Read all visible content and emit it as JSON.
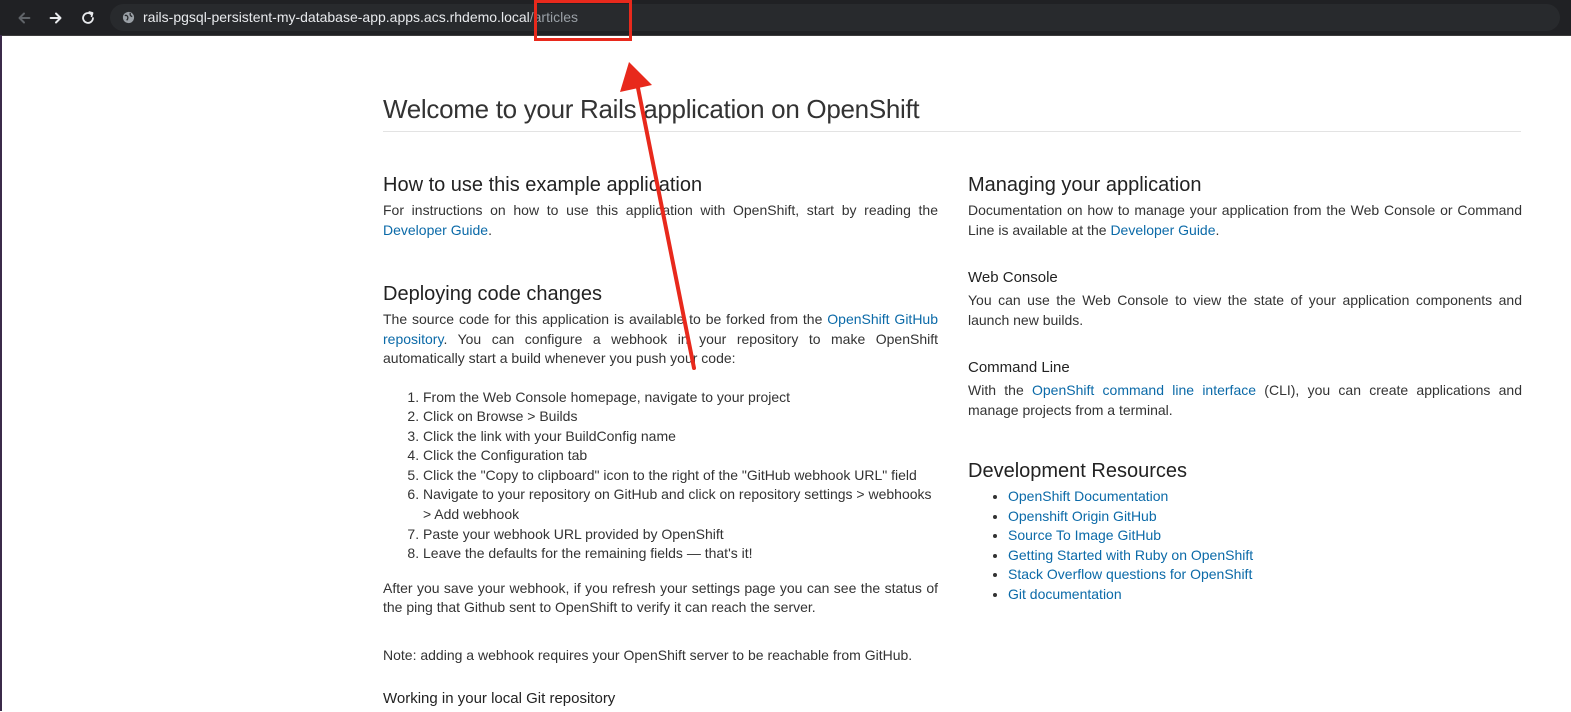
{
  "browser": {
    "url_host": "rails-pgsql-persistent-my-database-app.apps.acs.rhdemo.l",
    "url_host_tail": "ocal",
    "url_path": "/articles",
    "icons": [
      "back-arrow-icon",
      "forward-arrow-icon",
      "reload-icon",
      "globe-icon"
    ]
  },
  "page": {
    "title": "Welcome to your Rails application on OpenShift",
    "how_to": {
      "heading": "How to use this example application",
      "text": "For instructions on how to use this application with OpenShift, start by reading the ",
      "link": "Developer Guide",
      "text_end": "."
    },
    "deploying": {
      "heading": "Deploying code changes",
      "text1": "The source code for this application is available to be forked from the ",
      "link": "OpenShift GitHub repository",
      "text2": ". You can configure a webhook in your repository to make OpenShift automatically start a build whenever you push your code:",
      "steps": [
        "From the Web Console homepage, navigate to your project",
        "Click on Browse > Builds",
        "Click the link with your BuildConfig name",
        "Click the Configuration tab",
        "Click the \"Copy to clipboard\" icon to the right of the \"GitHub webhook URL\" field",
        "Navigate to your repository on GitHub and click on repository settings > webhooks > Add webhook",
        "Paste your webhook URL provided by OpenShift",
        "Leave the defaults for the remaining fields — that's it!"
      ],
      "after": "After you save your webhook, if you refresh your settings page you can see the status of the ping that Github sent to OpenShift to verify it can reach the server.",
      "note": "Note: adding a webhook requires your OpenShift server to be reachable from GitHub.",
      "cut_heading": "Working in your local Git repository"
    },
    "managing": {
      "heading": "Managing your application",
      "text": "Documentation on how to manage your application from the Web Console or Command Line is available at the ",
      "link": "Developer Guide",
      "text_end": "."
    },
    "web_console": {
      "heading": "Web Console",
      "text": "You can use the Web Console to view the state of your application components and launch new builds."
    },
    "command_line": {
      "heading": "Command Line",
      "text1": "With the ",
      "link": "OpenShift command line interface",
      "text2": " (CLI), you can create applications and manage projects from a terminal."
    },
    "resources": {
      "heading": "Development Resources",
      "links": [
        "OpenShift Documentation",
        "Openshift Origin GitHub",
        "Source To Image GitHub",
        "Getting Started with Ruby on OpenShift",
        "Stack Overflow questions for OpenShift",
        "Git documentation"
      ]
    }
  },
  "colors": {
    "annotation": "#e8291c",
    "link": "#0b6aa8",
    "browser_bar": "#202124"
  }
}
